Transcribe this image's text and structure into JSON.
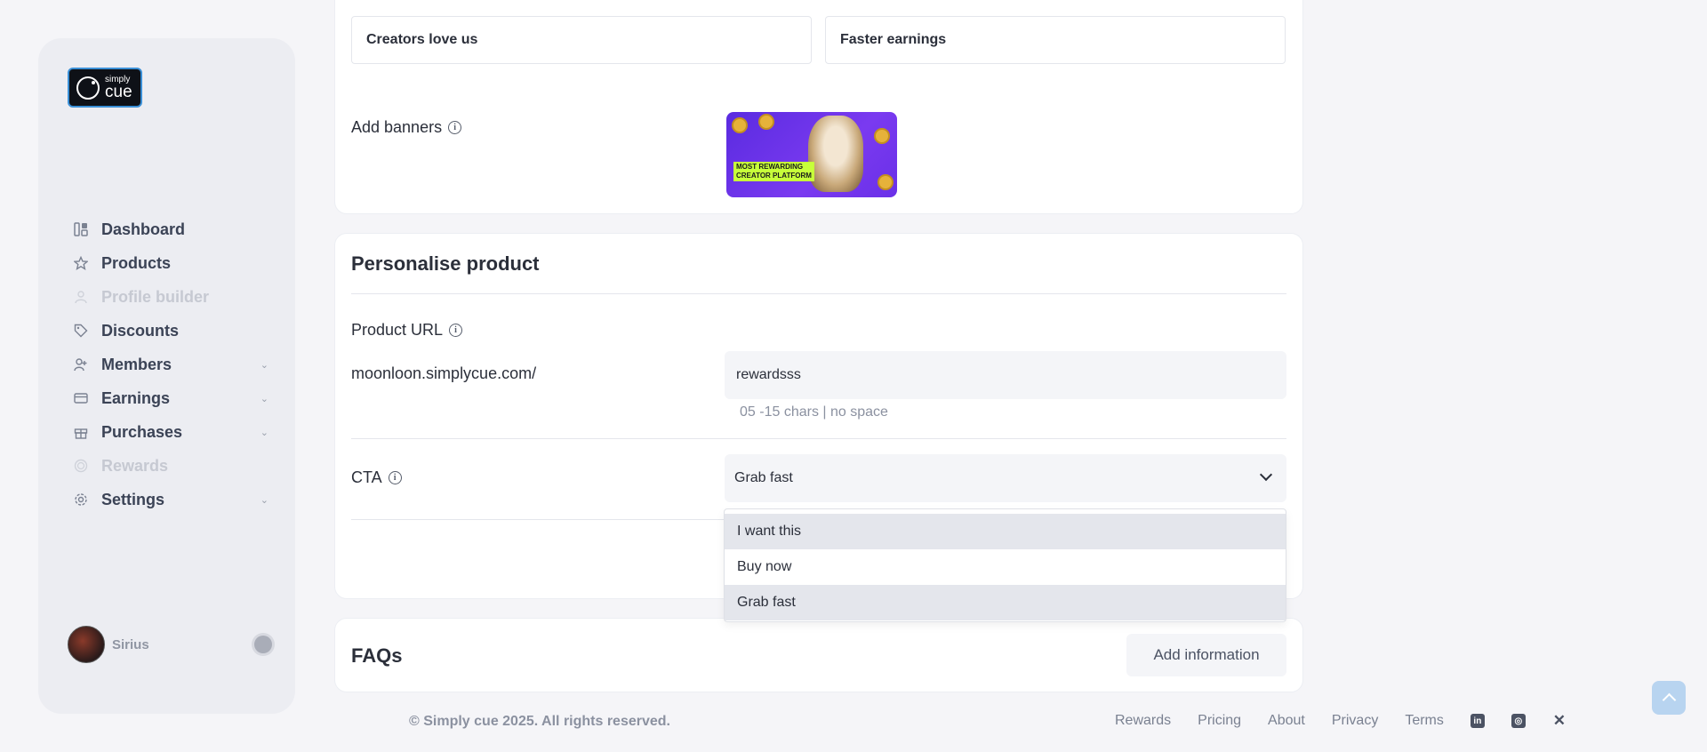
{
  "brand": {
    "logo_small": "simply",
    "logo_large": "cue"
  },
  "sidebar": {
    "items": [
      {
        "label": "Dashboard",
        "icon": "dashboard-icon",
        "disabled": false,
        "has_chevron": false
      },
      {
        "label": "Products",
        "icon": "star-icon",
        "disabled": false,
        "has_chevron": false
      },
      {
        "label": "Profile builder",
        "icon": "user-icon",
        "disabled": true,
        "has_chevron": false
      },
      {
        "label": "Discounts",
        "icon": "tag-icon",
        "disabled": false,
        "has_chevron": false
      },
      {
        "label": "Members",
        "icon": "members-icon",
        "disabled": false,
        "has_chevron": true
      },
      {
        "label": "Earnings",
        "icon": "card-icon",
        "disabled": false,
        "has_chevron": true
      },
      {
        "label": "Purchases",
        "icon": "gift-icon",
        "disabled": false,
        "has_chevron": true
      },
      {
        "label": "Rewards",
        "icon": "coin-icon",
        "disabled": true,
        "has_chevron": false
      },
      {
        "label": "Settings",
        "icon": "gear-icon",
        "disabled": false,
        "has_chevron": true
      }
    ],
    "user": {
      "name": "Sirius"
    }
  },
  "highlights": {
    "left": "Creators love us",
    "right": "Faster earnings"
  },
  "banners": {
    "label": "Add banners",
    "banner_text_line1": "MOST REWARDING",
    "banner_text_line2": "CREATOR PLATFORM"
  },
  "personalise": {
    "title": "Personalise product",
    "url_label": "Product URL",
    "url_prefix": "moonloon.simplycue.com/",
    "url_value": "rewardsss",
    "url_helper": "05 -15 chars | no space",
    "cta_label": "CTA",
    "cta_value": "Grab fast",
    "cta_options": [
      "I want this",
      "Buy now",
      "Grab fast"
    ]
  },
  "faqs": {
    "title": "FAQs",
    "add_button": "Add information"
  },
  "footer": {
    "copyright": "© Simply cue 2025. All rights reserved.",
    "links": [
      "Rewards",
      "Pricing",
      "About",
      "Privacy",
      "Terms"
    ],
    "social": [
      "linkedin-icon",
      "instagram-icon",
      "x-icon"
    ]
  }
}
